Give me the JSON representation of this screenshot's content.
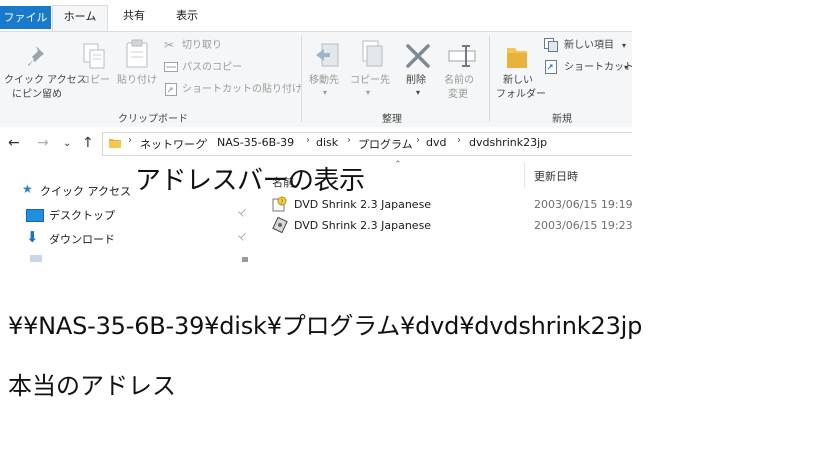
{
  "ribbon_tabs": [
    "ファイル",
    "ホーム",
    "共有",
    "表示"
  ],
  "ribbon": {
    "clipboard": {
      "pin_label_1": "クイック アクセス",
      "pin_label_2": "にピン留め",
      "copy": "コピー",
      "paste": "貼り付け",
      "cut": "切り取り",
      "copy_path": "パスのコピー",
      "paste_shortcut": "ショートカットの貼り付け",
      "title": "クリップボード"
    },
    "organize": {
      "move_to": "移動先",
      "copy_to": "コピー先",
      "delete": "削除",
      "rename_1": "名前の",
      "rename_2": "変更",
      "title": "整理"
    },
    "new": {
      "new_folder_1": "新しい",
      "new_folder_2": "フォルダー",
      "new_item": "新しい項目",
      "shortcut": "ショートカット",
      "title": "新規"
    }
  },
  "address": {
    "crumbs": [
      "ネットワーク",
      "NAS-35-6B-39",
      "disk",
      "プログラム",
      "dvd",
      "dvdshrink23jp"
    ]
  },
  "navpane": {
    "items": [
      "クイック アクセス",
      "デスクトップ",
      "ダウンロード"
    ]
  },
  "filelist": {
    "columns": {
      "name": "名前",
      "date": "更新日時"
    },
    "rows": [
      {
        "name": "DVD Shrink 2.3 Japanese",
        "date": "2003/06/15 19:19",
        "icon": "setup-icon"
      },
      {
        "name": "DVD Shrink 2.3 Japanese",
        "date": "2003/06/15 19:23",
        "icon": "disc-app-icon"
      }
    ]
  },
  "annotations": {
    "address_bar_caption": "アドレスバーの表示",
    "real_path": "¥¥NAS-35-6B-39¥disk¥プログラム¥dvd¥dvdshrink23jp",
    "real_address_caption": "本当のアドレス"
  },
  "colors": {
    "file_tab": "#1979ca",
    "ribbon_bg": "#f5f6f7",
    "folder": "#e8b33d"
  }
}
